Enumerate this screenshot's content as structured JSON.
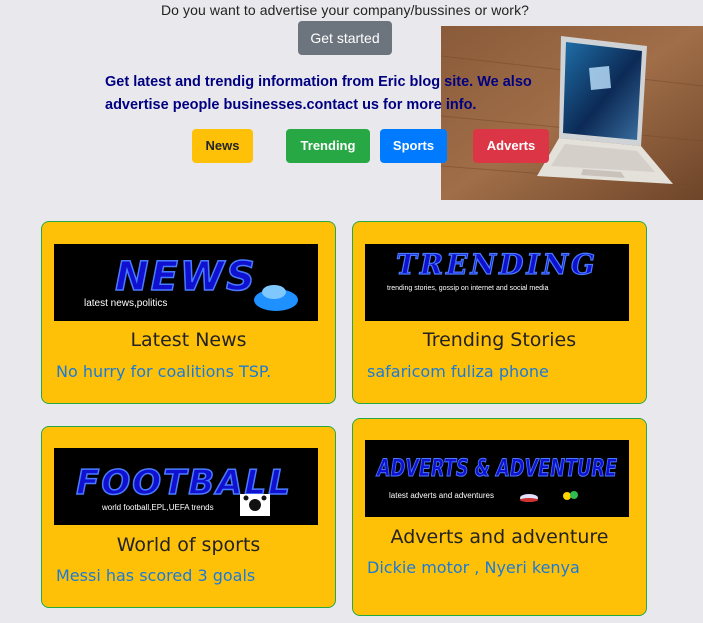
{
  "header": {
    "question": "Do you want to advertise your company/bussines or work?",
    "start_label": "Get started",
    "tagline": "Get latest and trendig information from Eric blog site. We also advertise people businesses.contact us for more info."
  },
  "nav": {
    "news_label": "News",
    "trending_label": "Trending",
    "sports_label": "Sports",
    "adverts_label": "Adverts"
  },
  "colors": {
    "news": "#ffc107",
    "trending": "#28a745",
    "sports": "#007bff",
    "adverts": "#dc3545",
    "card_bg": "#ffc107",
    "tagline": "#000080"
  },
  "cards": {
    "news": {
      "banner_title": "NEWS",
      "banner_sub": "latest news,politics",
      "title": "Latest News",
      "link": "No hurry for coalitions TSP."
    },
    "trending": {
      "banner_title": "TRENDING",
      "banner_sub": "trending stories, gossip on internet and social media",
      "title": "Trending Stories",
      "link": "safaricom fuliza phone"
    },
    "sports": {
      "banner_title": "FOOTBALL",
      "banner_sub": "world football,EPL,UEFA trends",
      "title": "World of sports",
      "link": "Messi has scored 3 goals"
    },
    "adverts": {
      "banner_title": "ADVERTS & ADVENTURE",
      "banner_sub": "latest adverts and adventures",
      "title": "Adverts and adventure",
      "link": "Dickie motor , Nyeri kenya"
    }
  }
}
